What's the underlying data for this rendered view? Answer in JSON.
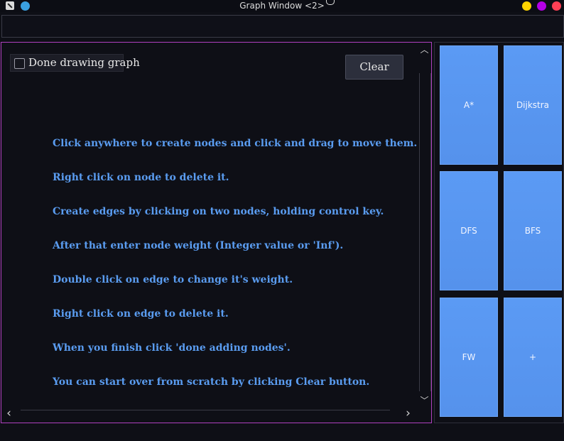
{
  "window": {
    "title": "Graph Window <2>",
    "colors": {
      "close": "#ff4055",
      "minimize": "#ffd400",
      "maximize": "#b400e6",
      "app_dot": "#3aa0e0"
    }
  },
  "canvas": {
    "done_checkbox_label": "Done drawing graph",
    "done_checked": false,
    "clear_label": "Clear",
    "instructions": [
      "Click anywhere to create nodes and click and drag to move them.",
      "Right click on node to delete it.",
      "Create edges by clicking on two nodes, holding control key.",
      "After that enter node weight (Integer value or 'Inf').",
      "Double click on edge to change it's weight.",
      "Right click on edge to delete it.",
      "When you finish click 'done adding nodes'.",
      "You can start over from scratch by clicking Clear button."
    ]
  },
  "scroll": {
    "up": "︿",
    "down": "﹀",
    "left": "‹",
    "right": "›"
  },
  "algorithms": [
    {
      "label": "A*"
    },
    {
      "label": "Dijkstra"
    },
    {
      "label": "DFS"
    },
    {
      "label": "BFS"
    },
    {
      "label": "FW"
    },
    {
      "label": "+"
    }
  ],
  "theme": {
    "accent_button": "#5b9af4",
    "instruction_text": "#5a9cf0",
    "canvas_border": "#b040c0"
  }
}
